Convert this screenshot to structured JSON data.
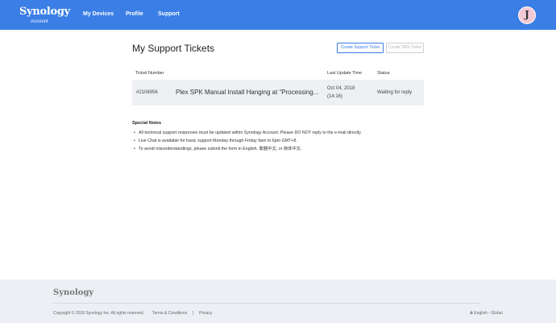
{
  "header": {
    "brand": "Synology",
    "brand_sub": "Account",
    "nav": [
      "My Devices",
      "Profile",
      "Support"
    ],
    "avatar_letter": "J",
    "bg_color": "#3a7ee6"
  },
  "main": {
    "title": "My Support Tickets",
    "buttons": {
      "create_support": "Create Support Ticket",
      "create_srs": "Create SRS Ticket"
    },
    "table": {
      "headers": [
        "Ticket Number",
        "Last Update Time",
        "Status"
      ],
      "rows": [
        {
          "number": "#2106956",
          "subject": "Plex SPK Manual Install Hanging at “Processing...",
          "date": "Oct 04, 2018",
          "time": "(14:16)",
          "status": "Waiting for reply"
        }
      ]
    }
  },
  "notes": {
    "title": "Special Notes",
    "items": [
      "All technical support responses must be updated within Synology Account. Please DO NOT reply to the e-mail directly.",
      "Live Chat is available for basic support Monday through Friday 9am to 6pm GMT+8.",
      "To avoid misunderstandings, please submit the form in English, 繁體中文, or 简体中文."
    ]
  },
  "footer": {
    "logo": "Synology",
    "copyright": "Copyright © 2018 Synology Inc. All rights reserved.",
    "terms": "Terms & Conditions",
    "separator": "|",
    "privacy": "Privacy",
    "language": "English - Global"
  }
}
